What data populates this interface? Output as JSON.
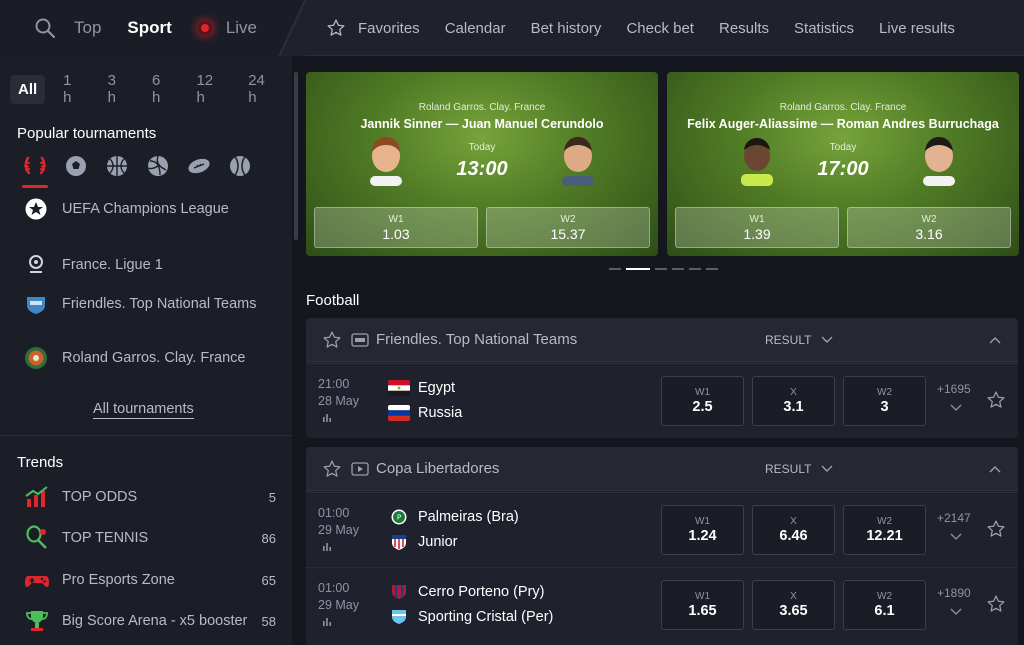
{
  "top": {
    "tabs": [
      "Top",
      "Sport",
      "Live"
    ],
    "nav": [
      "Favorites",
      "Calendar",
      "Bet history",
      "Check bet",
      "Results",
      "Statistics",
      "Live results"
    ]
  },
  "sidebar": {
    "time_filters": [
      "All",
      "1 h",
      "3 h",
      "6 h",
      "12 h",
      "24 h"
    ],
    "popular_title": "Popular tournaments",
    "sport_icons": [
      "laurel-icon",
      "football-icon",
      "basketball-icon",
      "volleyball-icon",
      "rugby-icon",
      "tennis-icon"
    ],
    "tournaments": [
      {
        "label": "UEFA Champions League",
        "icon": "champions-league-icon"
      },
      {
        "label": "France. Ligue 1",
        "icon": "ligue1-icon"
      },
      {
        "label": "Friendles. Top National Teams",
        "icon": "national-teams-icon"
      },
      {
        "label": "Roland Garros. Clay. France",
        "icon": "roland-garros-icon"
      }
    ],
    "all_tournaments": "All tournaments",
    "trends_title": "Trends",
    "trends": [
      {
        "label": "TOP ODDS",
        "count": "5",
        "icon": "chart-up-icon"
      },
      {
        "label": "TOP TENNIS",
        "count": "86",
        "icon": "tennis-racket-icon"
      },
      {
        "label": "Pro Esports Zone",
        "count": "65",
        "icon": "gamepad-icon"
      },
      {
        "label": "Big Score Arena - x5 booster",
        "count": "58",
        "icon": "trophy-icon"
      }
    ]
  },
  "featured": [
    {
      "league": "Roland Garros. Clay. France",
      "teams": "Jannik Sinner — Juan Manuel Cerundolo",
      "when": "Today",
      "time": "13:00",
      "w1_label": "W1",
      "w1": "1.03",
      "w2_label": "W2",
      "w2": "15.37"
    },
    {
      "league": "Roland Garros. Clay. France",
      "teams": "Felix Auger-Aliassime — Roman Andres Burruchaga",
      "when": "Today",
      "time": "17:00",
      "w1_label": "W1",
      "w1": "1.39",
      "w2_label": "W2",
      "w2": "3.16"
    }
  ],
  "section_title": "Football",
  "blocks": [
    {
      "name": "Friendles. Top National Teams",
      "result_label": "RESULT",
      "matches": [
        {
          "time": "21:00",
          "date": "28 May",
          "team1": "Egypt",
          "team2": "Russia",
          "odds": [
            {
              "label": "W1",
              "value": "2.5"
            },
            {
              "label": "X",
              "value": "3.1"
            },
            {
              "label": "W2",
              "value": "3"
            }
          ],
          "more": "+1695"
        }
      ]
    },
    {
      "name": "Copa Libertadores",
      "result_label": "RESULT",
      "matches": [
        {
          "time": "01:00",
          "date": "29 May",
          "team1": "Palmeiras (Bra)",
          "team2": "Junior",
          "odds": [
            {
              "label": "W1",
              "value": "1.24"
            },
            {
              "label": "X",
              "value": "6.46"
            },
            {
              "label": "W2",
              "value": "12.21"
            }
          ],
          "more": "+2147"
        },
        {
          "time": "01:00",
          "date": "29 May",
          "team1": "Cerro Porteno (Pry)",
          "team2": "Sporting Cristal (Per)",
          "odds": [
            {
              "label": "W1",
              "value": "1.65"
            },
            {
              "label": "X",
              "value": "3.65"
            },
            {
              "label": "W2",
              "value": "6.1"
            }
          ],
          "more": "+1890"
        }
      ]
    }
  ],
  "colors": {
    "accent": "#e0252d",
    "background": "#15171f",
    "panel": "#1f222c",
    "pitch": "#5f8a2c"
  }
}
